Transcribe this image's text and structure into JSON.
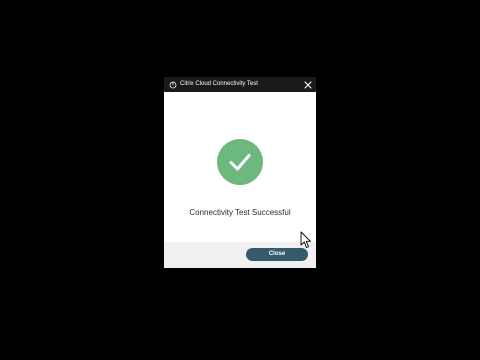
{
  "dialog": {
    "title": "Citrix Cloud Connectivity Test",
    "title_icon": "cloud-icon",
    "close_icon": "close-icon",
    "status_icon": "checkmark-icon",
    "message": "Connectivity Test Successful",
    "close_label": "Close"
  },
  "colors": {
    "background": "#000000",
    "titlebar": "#1a1a1a",
    "success": "#6db87e",
    "button": "#355a6a",
    "footer": "#f1f1f1"
  },
  "cursor_icon": "mouse-pointer-icon"
}
